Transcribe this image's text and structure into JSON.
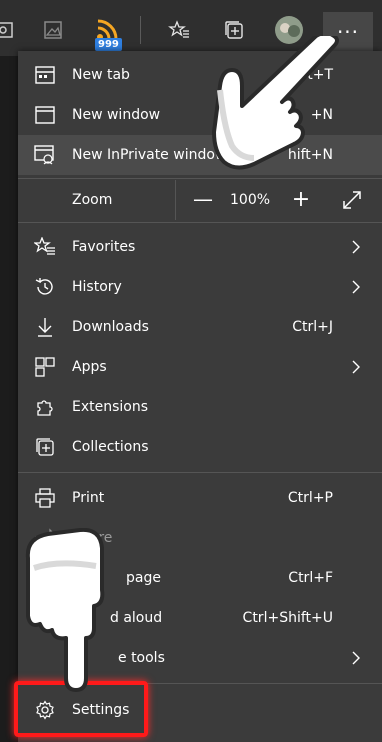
{
  "toolbar": {
    "rss_badge": "999",
    "more_label": "···"
  },
  "menu": {
    "new_tab": {
      "label": "New tab",
      "shortcut": "t+T"
    },
    "new_window": {
      "label": "New window",
      "shortcut": "+N"
    },
    "new_inprivate": {
      "label": "New InPrivate window",
      "shortcut": "hift+N"
    },
    "zoom": {
      "label": "Zoom",
      "minus": "—",
      "value": "100%",
      "plus": "+"
    },
    "favorites": {
      "label": "Favorites"
    },
    "history": {
      "label": "History"
    },
    "downloads": {
      "label": "Downloads",
      "shortcut": "Ctrl+J"
    },
    "apps": {
      "label": "Apps"
    },
    "extensions": {
      "label": "Extensions"
    },
    "collections": {
      "label": "Collections"
    },
    "print": {
      "label": "Print",
      "shortcut": "Ctrl+P"
    },
    "share": {
      "label": "Share"
    },
    "find": {
      "label": "page",
      "shortcut": "Ctrl+F"
    },
    "read_aloud": {
      "label": "d aloud",
      "shortcut": "Ctrl+Shift+U"
    },
    "more_tools": {
      "label": "e tools"
    },
    "settings": {
      "label": "Settings"
    }
  },
  "colors": {
    "menu_bg": "#3b3b3b",
    "toolbar_bg": "#2f2f2f",
    "highlight": "#4b4b4b",
    "settings_outline": "#ff1a1a",
    "badge": "#2f7fe0"
  }
}
